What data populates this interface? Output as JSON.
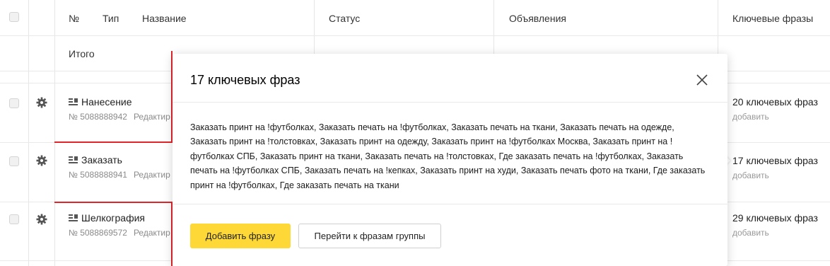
{
  "table": {
    "headers": {
      "number": "№",
      "type": "Тип",
      "name": "Название",
      "status": "Статус",
      "ads": "Объявления",
      "keywords": "Ключевые фразы"
    },
    "total_label": "Итого",
    "rows": [
      {
        "name": "Нанесение",
        "id": "№ 5088888942",
        "edit": "Редактир",
        "keywords": "20 ключевых фраз",
        "add": "добавить"
      },
      {
        "name": "Заказать",
        "id": "№ 5088888941",
        "edit": "Редактир",
        "keywords": "17 ключевых фраз",
        "add": "добавить"
      },
      {
        "name": "Шелкография",
        "id": "№ 5088869572",
        "edit": "Редактир",
        "keywords": "29 ключевых фраз",
        "add": "добавить"
      }
    ]
  },
  "popup": {
    "title": "17 ключевых фраз",
    "phrases": "Заказать принт на !футболках, Заказать печать на !футболках, Заказать печать на ткани, Заказать печать на одежде, Заказать принт на !толстовках, Заказать принт на одежду, Заказать принт на !футболках Москва, Заказать принт на !футболках СПБ, Заказать принт на ткани, Заказать печать на !толстовках, Где заказать печать на !футболках, Заказать печать на !футболках СПБ, Заказать печать на !кепках, Заказать принт на худи, Заказать печать фото на ткани, Где заказать принт на !футболках, Где заказать печать на ткани",
    "add_button": "Добавить фразу",
    "group_button": "Перейти к фразам группы"
  },
  "colors": {
    "accent_button": "#fdd836",
    "annotation_red": "#e0262b"
  },
  "icons": {
    "row_settings": "gear-icon",
    "row_type": "text-ad-icon",
    "popup_close": "close-icon"
  }
}
